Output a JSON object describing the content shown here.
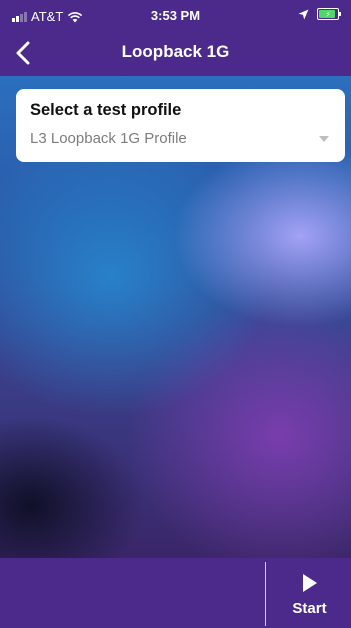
{
  "status_bar": {
    "carrier": "AT&T",
    "time": "3:53 PM",
    "icons": [
      "signal-icon",
      "wifi-icon",
      "location-icon",
      "battery-charging-icon"
    ]
  },
  "nav": {
    "title": "Loopback 1G",
    "back_icon": "chevron-left-icon"
  },
  "profile_card": {
    "title": "Select a test profile",
    "selected_profile": "L3 Loopback 1G Profile",
    "dropdown_icon": "caret-down-icon"
  },
  "bottom_bar": {
    "start_label": "Start",
    "start_icon": "play-icon"
  },
  "colors": {
    "brand_purple": "#4b2a8c",
    "battery_green": "#4cd964"
  }
}
